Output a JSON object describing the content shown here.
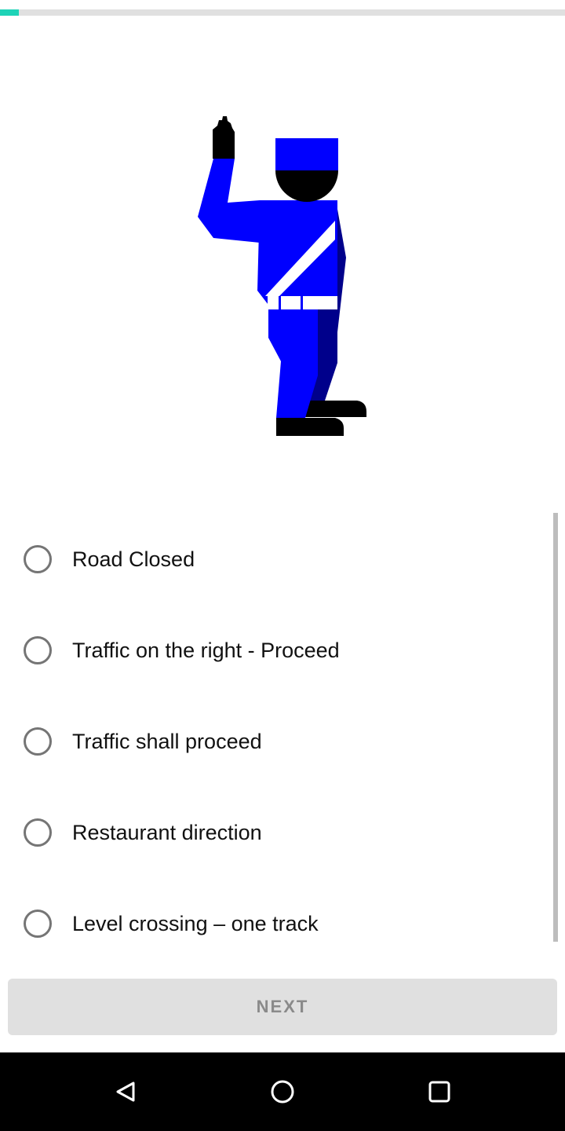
{
  "progress": {
    "fraction": 0.033,
    "color": "#1ed3b7"
  },
  "illustration": {
    "icon": "traffic-police-hand-signal",
    "uniform_color": "#0000ff",
    "shadow_color": "#00008b"
  },
  "question": {
    "options": [
      {
        "label": "Road Closed",
        "selected": false
      },
      {
        "label": "Traffic on the right - Proceed",
        "selected": false
      },
      {
        "label": "Traffic shall proceed",
        "selected": false
      },
      {
        "label": "Restaurant direction",
        "selected": false
      },
      {
        "label": "Level crossing – one track",
        "selected": false
      }
    ]
  },
  "next_button": {
    "label": "NEXT",
    "enabled": false
  },
  "nav": {
    "back_icon": "back-triangle-icon",
    "home_icon": "home-circle-icon",
    "recents_icon": "recents-square-icon"
  }
}
